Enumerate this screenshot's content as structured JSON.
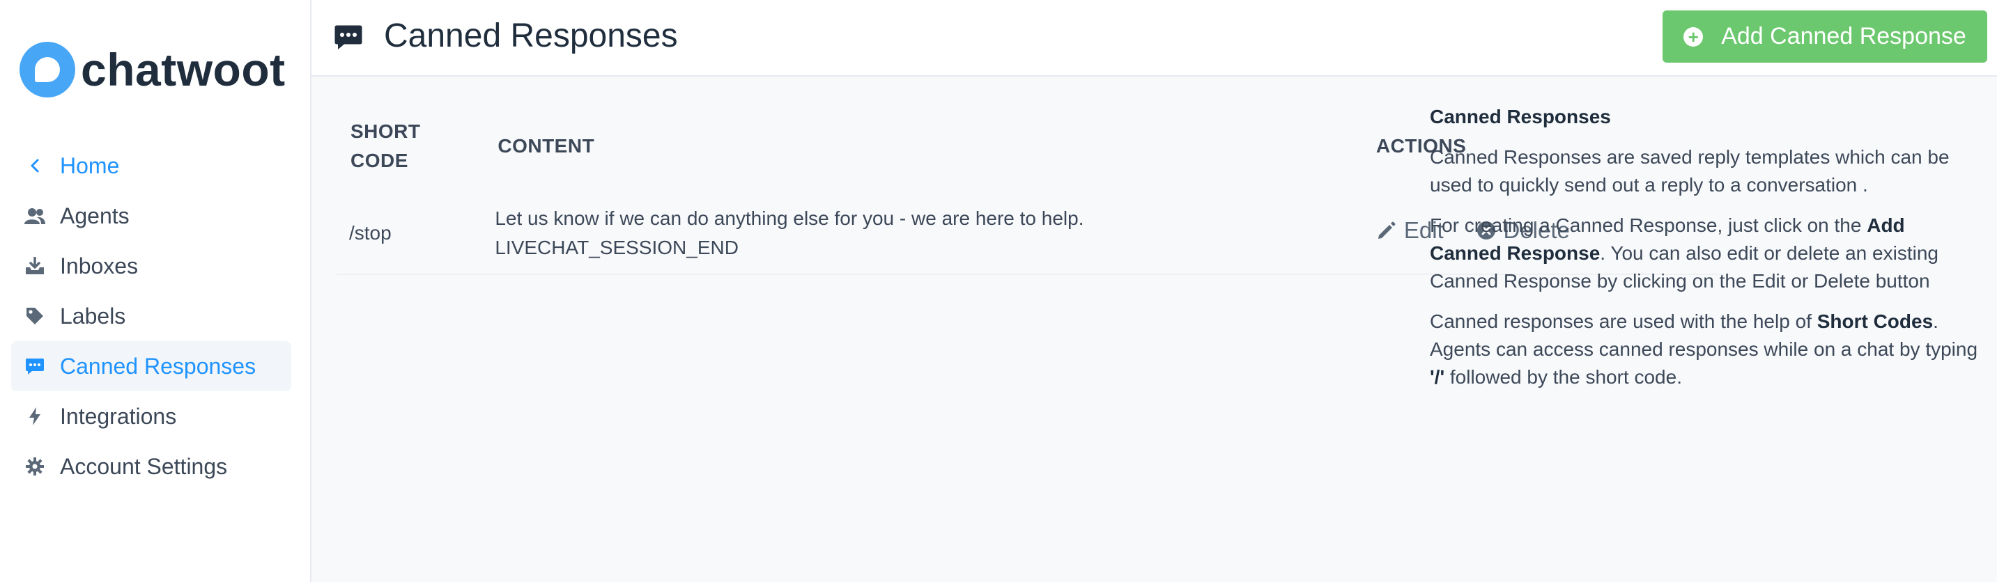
{
  "brand": {
    "name": "chatwoot",
    "accent": "#1f93ff",
    "logo_color": "#47a7f6"
  },
  "sidebar": {
    "items": [
      {
        "label": "Home",
        "icon": "chevron-left-icon"
      },
      {
        "label": "Agents",
        "icon": "people-icon"
      },
      {
        "label": "Inboxes",
        "icon": "inbox-icon"
      },
      {
        "label": "Labels",
        "icon": "tag-icon"
      },
      {
        "label": "Canned Responses",
        "icon": "chat-bubble-icon",
        "active": true
      },
      {
        "label": "Integrations",
        "icon": "lightning-icon"
      },
      {
        "label": "Account Settings",
        "icon": "gear-icon"
      }
    ]
  },
  "header": {
    "title": "Canned Responses",
    "add_button": "Add Canned Response",
    "add_button_color": "#6cc86e"
  },
  "table": {
    "headers": {
      "short_code_1": "SHORT",
      "short_code_2": "CODE",
      "content": "CONTENT",
      "actions": "ACTIONS"
    },
    "rows": [
      {
        "short_code": "/stop",
        "content_line1": "Let us know if we can do anything else for you - we are here to help.",
        "content_line2": "LIVECHAT_SESSION_END",
        "edit": "Edit",
        "delete": "Delete"
      }
    ]
  },
  "help": {
    "title": "Canned Responses",
    "p1": "Canned Responses are saved reply templates which can be used to quickly send out a reply to a conversation .",
    "p2_a": "For creating a Canned Response, just click on the ",
    "p2_b": "Add Canned Response",
    "p2_c": ". You can also edit or delete an existing Canned Response by clicking on the Edit or Delete button",
    "p3_a": "Canned responses are used with the help of ",
    "p3_b": "Short Codes",
    "p3_c": ". Agents can access canned responses while on a chat by typing ",
    "p3_d": "'/'",
    "p3_e": " followed by the short code."
  }
}
